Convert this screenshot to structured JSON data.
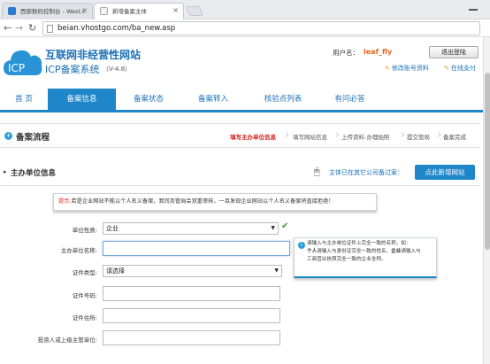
{
  "browser": {
    "tabs": [
      {
        "title": "西部数码控制台 - West.c"
      },
      {
        "title": "新增备案主体"
      }
    ],
    "url": "beian.vhostgo.com/ba_new.asp"
  },
  "site": {
    "logo_text": "ICP",
    "title": "互联网非经营性网站",
    "subtitle": "ICP备案系统",
    "version": "（V-4.8）",
    "user_label": "用户名：",
    "user_name": "leaf_fly",
    "logout": "退出登陆",
    "link_profile": "修改账号资料",
    "link_pay": "在线支付"
  },
  "nav": {
    "items": [
      {
        "label": "首 页",
        "active": false
      },
      {
        "label": "备案信息",
        "active": true
      },
      {
        "label": "备案状态",
        "active": false
      },
      {
        "label": "备案转入",
        "active": false
      },
      {
        "label": "核验点列表",
        "active": false
      },
      {
        "label": "有问必答",
        "active": false
      }
    ]
  },
  "process": {
    "title": "备案流程",
    "steps": [
      {
        "label": "填写主办单位信息",
        "current": true
      },
      {
        "label": "填写网站信息",
        "current": false
      },
      {
        "label": "上传资料-办理拍照",
        "current": false
      },
      {
        "label": "提交管局",
        "current": false
      },
      {
        "label": "备案完成",
        "current": false
      }
    ]
  },
  "section": {
    "title": "主办单位信息",
    "question": "主体已在其它公司备过案：",
    "add_button": "点此新增网站"
  },
  "tip": {
    "label": "提示:",
    "text": "若是企业网站不能以个人名义备案，我司及管局会双重审核，一旦发现企业网站以个人名义备案将直接拒绝！"
  },
  "form": {
    "unit_type_label": "单位性质:",
    "unit_type_value": "企业",
    "unit_name_label": "主办单位名称:",
    "cert_type_label": "证件类型:",
    "cert_type_value": "请选择",
    "cert_no_label": "证件号码:",
    "cert_addr_label": "证件住所:",
    "investor_label": "投资人或上级主管单位:"
  },
  "hint": {
    "line1": "请输入与主办单位证件上完全一致的名称，如：",
    "line2_bold_a": "个人",
    "line2": "请输入与身份证完全一致的姓名，",
    "line2_bold_b": "企业",
    "line2_end": "请输入与",
    "line3": "工商营业执照完全一致的企业全称。"
  },
  "colors": {
    "brand_blue": "#1f86c9",
    "link_blue": "#1c6fb7",
    "accent_orange": "#e8641b",
    "current_red": "#d8201f",
    "check_green": "#3aa034"
  }
}
